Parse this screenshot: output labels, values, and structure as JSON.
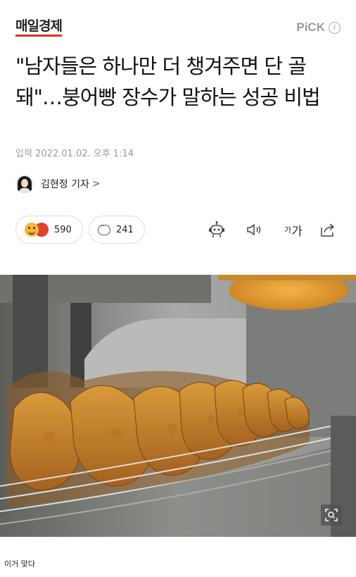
{
  "header": {
    "logo": "매일경제",
    "pick_label": "PiCK",
    "info_glyph": "i"
  },
  "article": {
    "title": "\"남자들은 하나만 더 챙겨주면 단 골돼\"…붕어빵 장수가 말하는 성공 비법",
    "date": "입력 2022.01.02. 오후 1:14",
    "reporter": "김현정 기자",
    "reporter_chevron": ">"
  },
  "actions": {
    "reactions_count": "590",
    "comments_count": "241",
    "text_size_label_small": "가",
    "text_size_label_large": "가",
    "tools": [
      "robot-summary-icon",
      "speaker-icon",
      "text-size-icon",
      "share-icon"
    ]
  },
  "photo": {
    "subject": "bungeoppang",
    "zoom_icon": "zoom-icon"
  },
  "caption": "이거 맞다",
  "colors": {
    "logo_underline": "#d9331f",
    "pick_gray": "#9a9a9a",
    "date_gray": "#9b9b9b"
  }
}
